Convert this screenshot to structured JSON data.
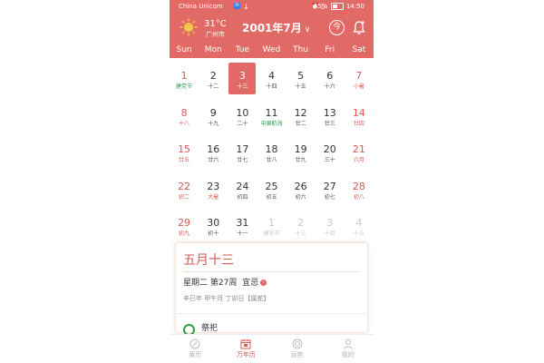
{
  "status": {
    "carrier": "China Unicom",
    "battery": "45%",
    "time": "14:50"
  },
  "header": {
    "temperature": "31°C",
    "city": "广州市",
    "month_label": "2001年7月",
    "today_label": "今"
  },
  "weekdays": [
    "Sun",
    "Mon",
    "Tue",
    "Wed",
    "Thu",
    "Fri",
    "Sat"
  ],
  "calendar": {
    "selected": "3",
    "days": [
      {
        "day": "1",
        "lunar": "建党节",
        "type": "holiday-weekend"
      },
      {
        "day": "2",
        "lunar": "十二",
        "type": ""
      },
      {
        "day": "3",
        "lunar": "十三",
        "type": "selected"
      },
      {
        "day": "4",
        "lunar": "十四",
        "type": ""
      },
      {
        "day": "5",
        "lunar": "十五",
        "type": ""
      },
      {
        "day": "6",
        "lunar": "十六",
        "type": ""
      },
      {
        "day": "7",
        "lunar": "小暑",
        "type": "weekend"
      },
      {
        "day": "8",
        "lunar": "十八",
        "type": "weekend"
      },
      {
        "day": "9",
        "lunar": "十九",
        "type": ""
      },
      {
        "day": "10",
        "lunar": "二十",
        "type": ""
      },
      {
        "day": "11",
        "lunar": "中国航海",
        "type": "holiday"
      },
      {
        "day": "12",
        "lunar": "廿二",
        "type": ""
      },
      {
        "day": "13",
        "lunar": "廿三",
        "type": ""
      },
      {
        "day": "14",
        "lunar": "廿四",
        "type": "weekend"
      },
      {
        "day": "15",
        "lunar": "廿五",
        "type": "weekend"
      },
      {
        "day": "16",
        "lunar": "廿六",
        "type": ""
      },
      {
        "day": "17",
        "lunar": "廿七",
        "type": ""
      },
      {
        "day": "18",
        "lunar": "廿八",
        "type": ""
      },
      {
        "day": "19",
        "lunar": "廿九",
        "type": ""
      },
      {
        "day": "20",
        "lunar": "三十",
        "type": ""
      },
      {
        "day": "21",
        "lunar": "六月",
        "type": "weekend"
      },
      {
        "day": "22",
        "lunar": "初二",
        "type": "weekend"
      },
      {
        "day": "23",
        "lunar": "大暑",
        "type": "term"
      },
      {
        "day": "24",
        "lunar": "初四",
        "type": ""
      },
      {
        "day": "25",
        "lunar": "初五",
        "type": ""
      },
      {
        "day": "26",
        "lunar": "初六",
        "type": ""
      },
      {
        "day": "27",
        "lunar": "初七",
        "type": ""
      },
      {
        "day": "28",
        "lunar": "初八",
        "type": "weekend"
      },
      {
        "day": "29",
        "lunar": "初九",
        "type": "weekend"
      },
      {
        "day": "30",
        "lunar": "初十",
        "type": ""
      },
      {
        "day": "31",
        "lunar": "十一",
        "type": ""
      },
      {
        "day": "1",
        "lunar": "建军节",
        "type": "dim"
      },
      {
        "day": "2",
        "lunar": "十三",
        "type": "dim"
      },
      {
        "day": "3",
        "lunar": "十四",
        "type": "dim"
      },
      {
        "day": "4",
        "lunar": "十五",
        "type": "dim"
      }
    ]
  },
  "info": {
    "lunar_date": "五月十三",
    "weekday_week": "星期二 第27周",
    "yi_ji": "宜忌",
    "ganzhi": "辛巳年 甲午月 丁卯日【属蛇】",
    "wish": "祭祀"
  },
  "nav": [
    {
      "label": "黄历",
      "active": false,
      "icon": "compass-icon"
    },
    {
      "label": "万年历",
      "active": true,
      "icon": "calendar-icon"
    },
    {
      "label": "运势",
      "active": false,
      "icon": "fortune-icon"
    },
    {
      "label": "我的",
      "active": false,
      "icon": "person-icon"
    }
  ],
  "colors": {
    "accent": "#e26a66",
    "holiday_green": "#2f9a4a"
  }
}
